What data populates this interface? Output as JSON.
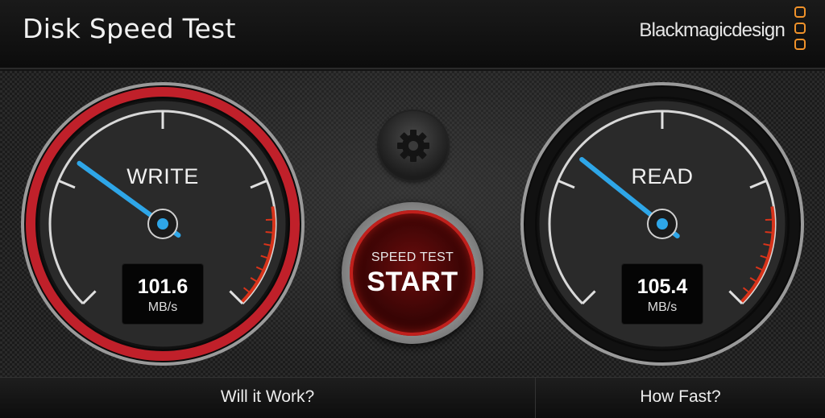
{
  "header": {
    "title": "Disk Speed Test",
    "brand": "Blackmagicdesign"
  },
  "gauges": {
    "write": {
      "title": "WRITE",
      "value": "101.6",
      "unit": "MB/s",
      "level": 0.3
    },
    "read": {
      "title": "READ",
      "value": "105.4",
      "unit": "MB/s",
      "level": 0.31
    }
  },
  "controls": {
    "settings_icon": "gear-icon",
    "start_small": "SPEED TEST",
    "start_big": "START"
  },
  "footer": {
    "tab_will_it_work": "Will it Work?",
    "tab_how_fast": "How Fast?"
  },
  "colors": {
    "needle": "#2ea6e8",
    "write_ring": "#c0202a",
    "red_zone": "#d8331a",
    "brand_accent": "#f0922a"
  }
}
